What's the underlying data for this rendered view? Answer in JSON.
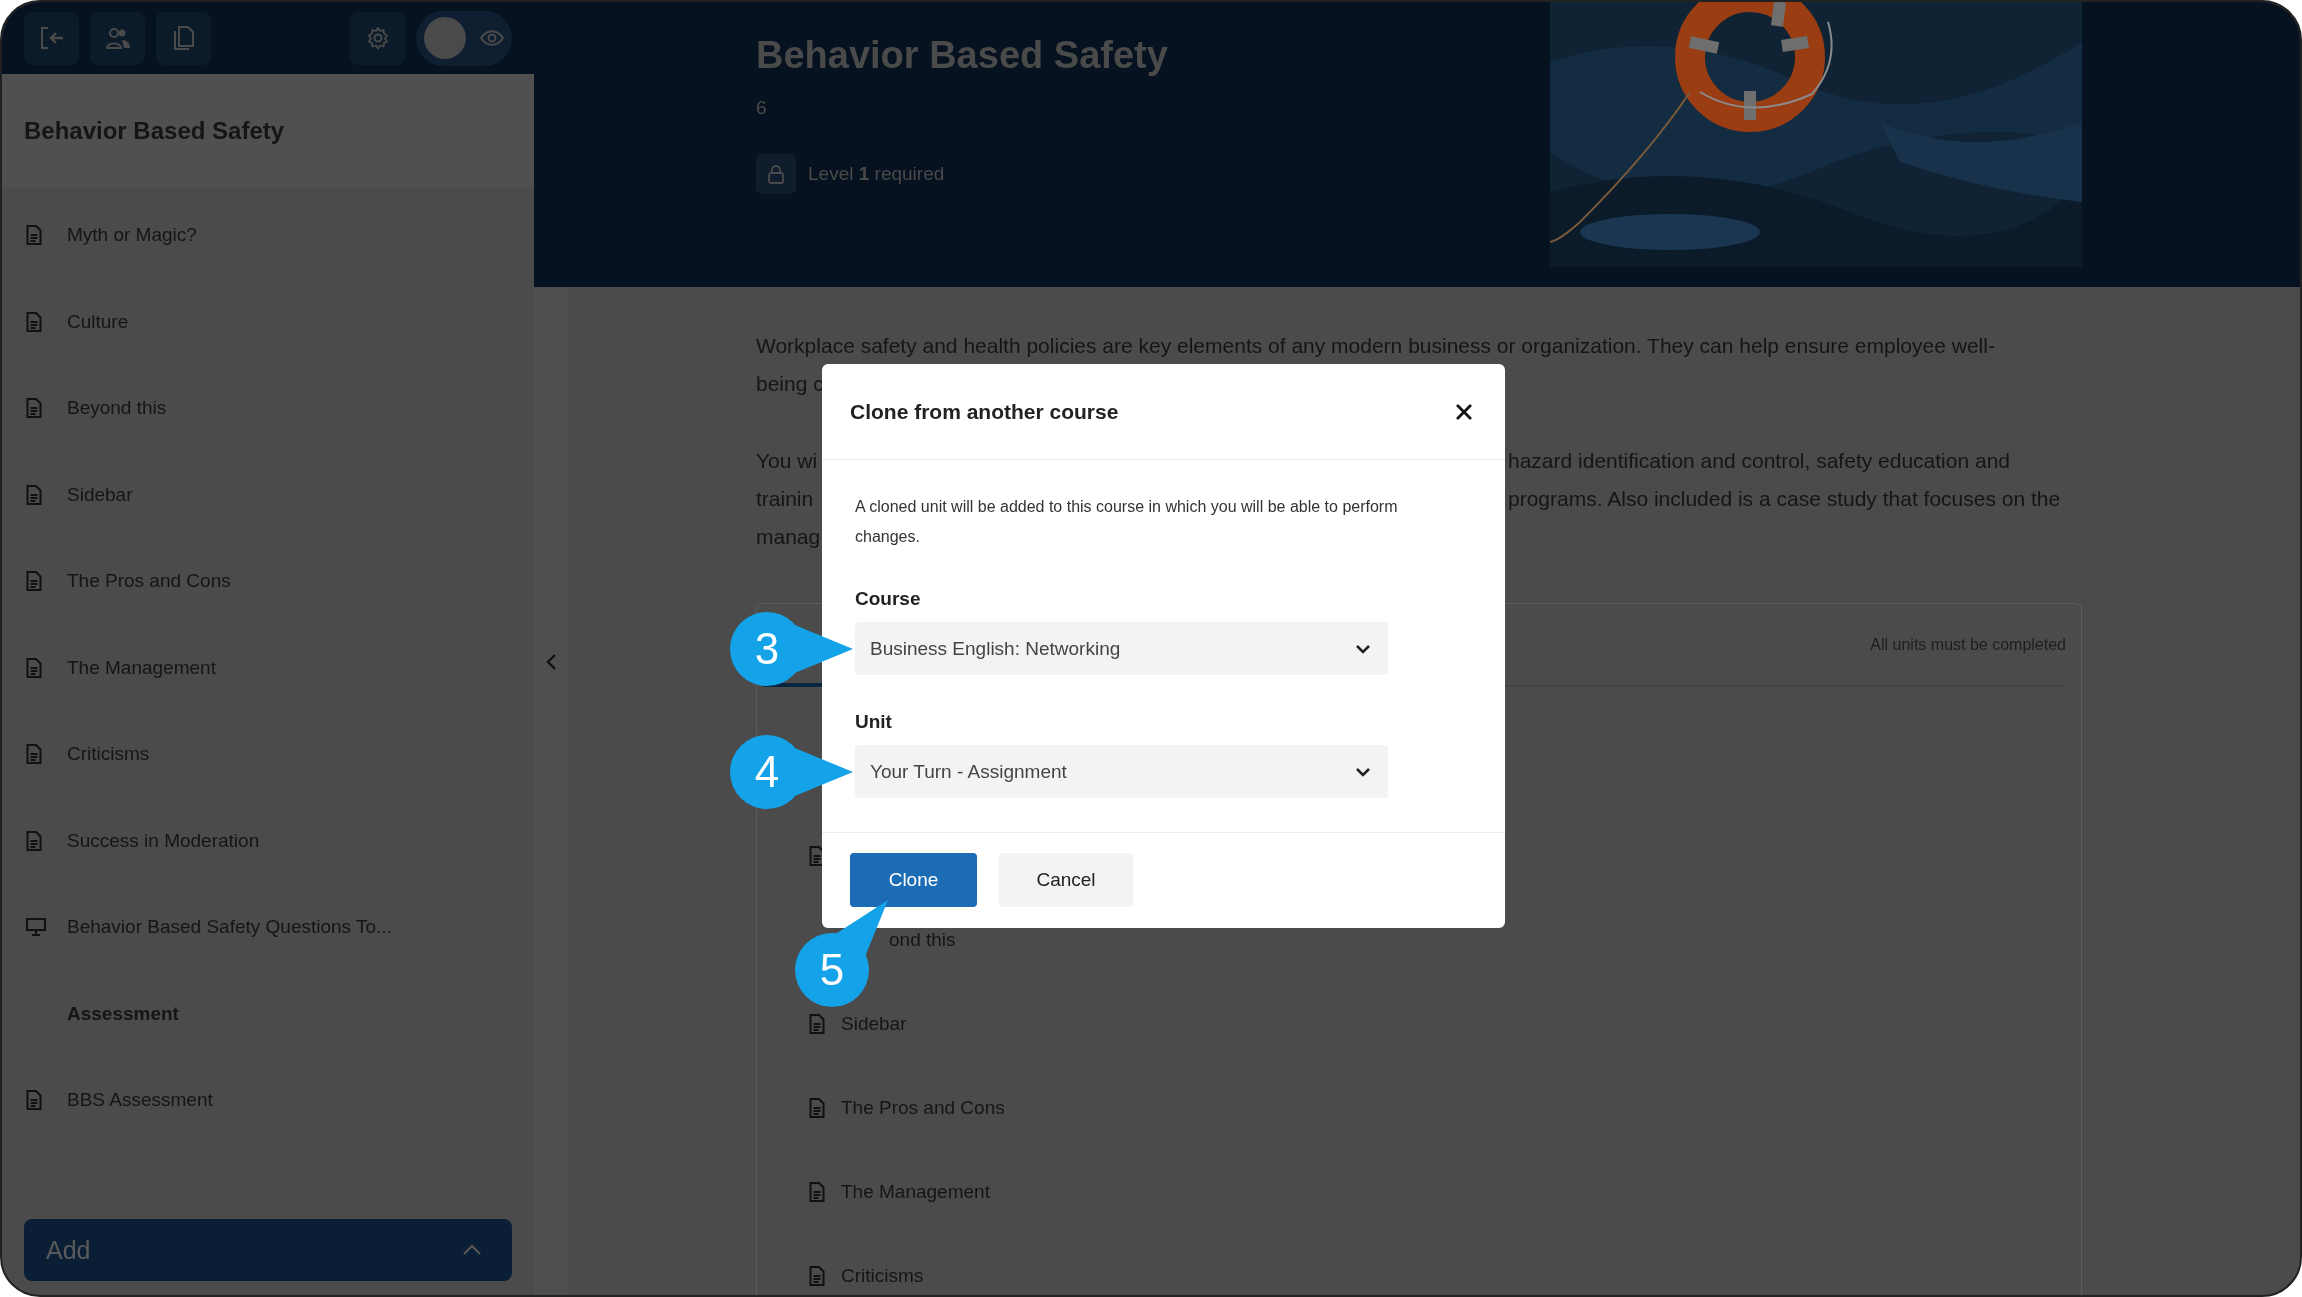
{
  "toolbar": {
    "preview_toggle": {
      "on": false
    }
  },
  "sidebar": {
    "title": "Behavior Based Safety",
    "items": [
      {
        "kind": "unit",
        "label": "Myth or Magic?"
      },
      {
        "kind": "unit",
        "label": "Culture"
      },
      {
        "kind": "unit",
        "label": "Beyond this"
      },
      {
        "kind": "unit",
        "label": "Sidebar"
      },
      {
        "kind": "unit",
        "label": "The Pros and Cons"
      },
      {
        "kind": "unit",
        "label": "The Management"
      },
      {
        "kind": "unit",
        "label": "Criticisms"
      },
      {
        "kind": "unit",
        "label": "Success in Moderation"
      },
      {
        "kind": "presentation",
        "label": "Behavior Based Safety Questions To..."
      },
      {
        "kind": "section",
        "label": "Assessment"
      },
      {
        "kind": "unit",
        "label": "BBS Assessment"
      }
    ],
    "add_button": "Add"
  },
  "header": {
    "title": "Behavior Based Safety",
    "count": "6",
    "requirement": "Level **1** required"
  },
  "content": {
    "paragraphs": [
      [
        {
          "start": "Workplace safety and health policies are key elements of any modern business or organization. They can help ensure employee well-"
        },
        {
          "start": "being c"
        }
      ],
      [
        {
          "start": "You wi",
          "end": "hazard identification and control, safety education and"
        },
        {
          "start": "trainin",
          "end": "programs. Also included is a case study that focuses on the"
        },
        {
          "start": "manag"
        }
      ]
    ]
  },
  "units": {
    "note": "All units must be completed",
    "items": [
      {
        "kind": "icon_only"
      },
      {
        "kind": "text_only",
        "label": "ond this"
      },
      {
        "kind": "unit",
        "label": "Sidebar"
      },
      {
        "kind": "unit",
        "label": "The Pros and Cons"
      },
      {
        "kind": "unit",
        "label": "The Management"
      },
      {
        "kind": "unit",
        "label": "Criticisms"
      }
    ]
  },
  "dialog": {
    "title": "Clone from another course",
    "description": "A cloned unit will be added to this course in which you will be able to perform changes.",
    "fields": [
      {
        "label": "Course",
        "value": "Business English: Networking",
        "callout": "3"
      },
      {
        "label": "Unit",
        "value": "Your Turn - Assignment",
        "callout": "4"
      }
    ],
    "buttons": [
      {
        "kind": "primary",
        "label": "Clone",
        "callout": "5"
      },
      {
        "kind": "secondary",
        "label": "Cancel"
      }
    ]
  }
}
